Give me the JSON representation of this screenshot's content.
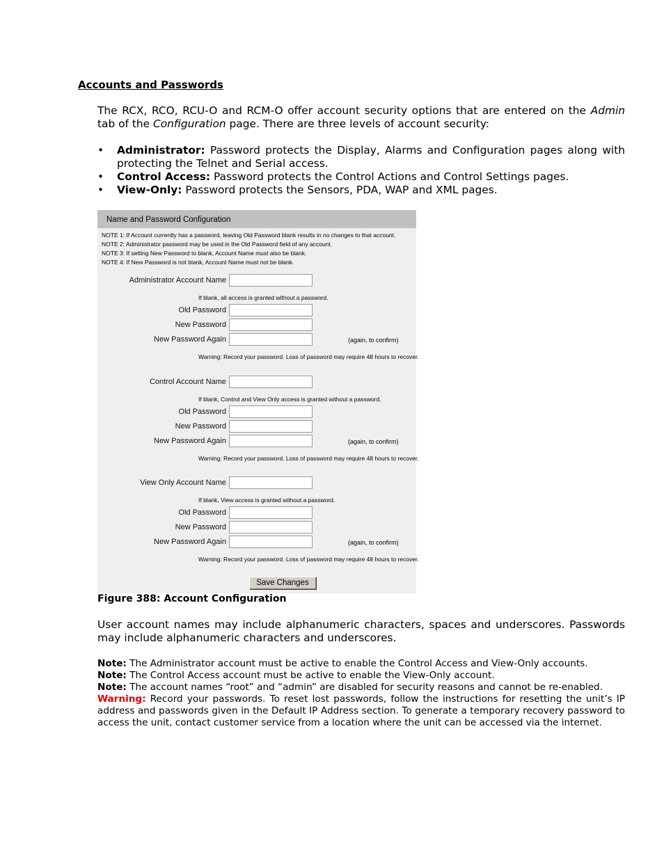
{
  "heading": "Accounts and Passwords",
  "intro": {
    "part1": "The RCX, RCO, RCU-O and RCM-O offer account security options that are entered on the ",
    "em1": "Admin",
    "part2": " tab of the ",
    "em2": "Configuration",
    "part3": " page.  There are three levels of account security:"
  },
  "bullets": [
    {
      "term": "Administrator:",
      "text": " Password protects the Display, Alarms and Configuration pages along with protecting the Telnet and Serial access."
    },
    {
      "term": "Control Access:",
      "text": " Password protects the Control Actions and Control Settings pages."
    },
    {
      "term": "View-Only:",
      "text": " Password protects the Sensors, PDA, WAP and XML pages."
    }
  ],
  "figure": {
    "title": "Name and Password Configuration",
    "notes": [
      "NOTE 1: If Account currently has a password, leaving Old Password blank results in no changes to that account.",
      "NOTE 2: Administrator password may be used in the Old Password field of any account.",
      "NOTE 3: If setting New Password to blank, Account Name must also be blank.",
      "NOTE 4: If New Password is not blank, Account Name must not be blank."
    ],
    "sections": [
      {
        "account_label": "Administrator Account Name",
        "blank_hint": "If blank, all access is granted without a password.",
        "old_label": "Old Password",
        "new_label": "New Password",
        "again_label": "New Password Again",
        "confirm_hint": "(again, to confirm)",
        "warning": "Warning: Record your password. Loss of password may require 48 hours to recover.",
        "values": {
          "account": "",
          "old": "",
          "new": "",
          "again": ""
        }
      },
      {
        "account_label": "Control Account Name",
        "blank_hint": "If blank, Control and View Only access is granted without a password.",
        "old_label": "Old Password",
        "new_label": "New Password",
        "again_label": "New Password Again",
        "confirm_hint": "(again, to confirm)",
        "warning": "Warning: Record your password. Loss of password may require 48 hours to recover.",
        "values": {
          "account": "",
          "old": "",
          "new": "",
          "again": ""
        }
      },
      {
        "account_label": "View Only Account Name",
        "blank_hint": "If blank, View access is granted without a password.",
        "old_label": "Old Password",
        "new_label": "New Password",
        "again_label": "New Password Again",
        "confirm_hint": "(again, to confirm)",
        "warning": "Warning: Record your password. Loss of password may require 48 hours to recover.",
        "values": {
          "account": "",
          "old": "",
          "new": "",
          "again": ""
        }
      }
    ],
    "save_label": "Save Changes",
    "caption": "Figure 388: Account Configuration"
  },
  "account_names_para": "User account names may include alphanumeric characters, spaces and underscores.  Passwords may include alphanumeric characters and underscores.",
  "notes": [
    {
      "label": "Note:",
      "text": " The Administrator account must be active to enable the Control Access and View-Only accounts."
    },
    {
      "label": "Note:",
      "text": " The Control Access account must be active to enable the View-Only account."
    },
    {
      "label": "Note:",
      "text": " The account names “root” and “admin” are disabled for security reasons and cannot be re-enabled."
    }
  ],
  "warning": {
    "label": "Warning:",
    "text": " Record your passwords.  To reset lost passwords, follow the instructions for resetting the unit’s IP address and passwords given in the Default IP Address section.  To generate a temporary recovery password to access the unit, contact customer service from a location where the unit can be accessed via the internet."
  },
  "colors": {
    "warning": "#e00000",
    "figure_bg": "#efefef",
    "figure_header": "#c0c0c0"
  }
}
